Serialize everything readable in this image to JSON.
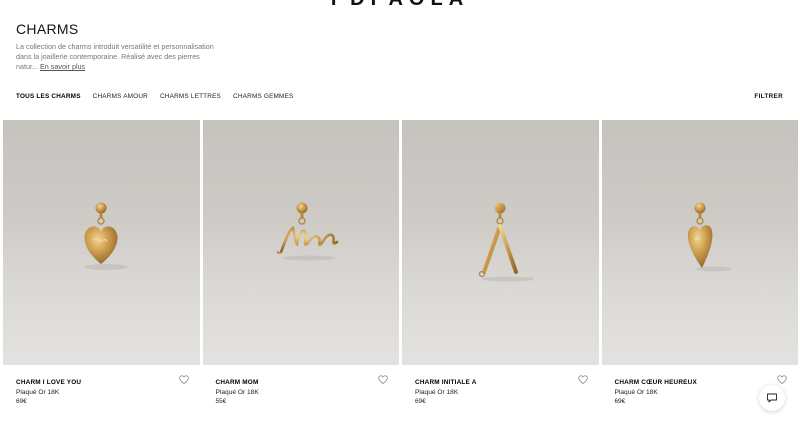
{
  "brand": "PDPAOLA",
  "page": {
    "title": "CHARMS",
    "intro": "La collection de charms introduit versatilité et personnalisation dans la joaillerie contemporaine. Réalisé avec des pierres natur...",
    "intro_link": "En savoir plus"
  },
  "filters": {
    "tabs": [
      "TOUS LES CHARMS",
      "CHARMS AMOUR",
      "CHARMS LETTRES",
      "CHARMS GEMMES"
    ],
    "active": "TOUS LES CHARMS",
    "filter_button": "FILTRER"
  },
  "products": [
    {
      "name": "CHARM I LOVE YOU",
      "material": "Plaqué Or 18K",
      "price": "69€",
      "icon": "heart-charm"
    },
    {
      "name": "CHARM MOM",
      "material": "Plaqué Or 18K",
      "price": "55€",
      "icon": "mom-script-charm"
    },
    {
      "name": "CHARM INITIALE A",
      "material": "Plaqué Or 18K",
      "price": "69€",
      "icon": "letter-a-charm"
    },
    {
      "name": "CHARM CŒUR HEUREUX",
      "material": "Plaqué Or 18K",
      "price": "69€",
      "icon": "long-heart-charm"
    }
  ],
  "colors": {
    "gold": "#c99a4a",
    "gold_light": "#e6c27a",
    "gold_dark": "#8f6427",
    "photo_bg": "#cfccc8"
  },
  "icons": {
    "wishlist": "heart-outline-icon",
    "chat": "chat-bubble-icon"
  }
}
